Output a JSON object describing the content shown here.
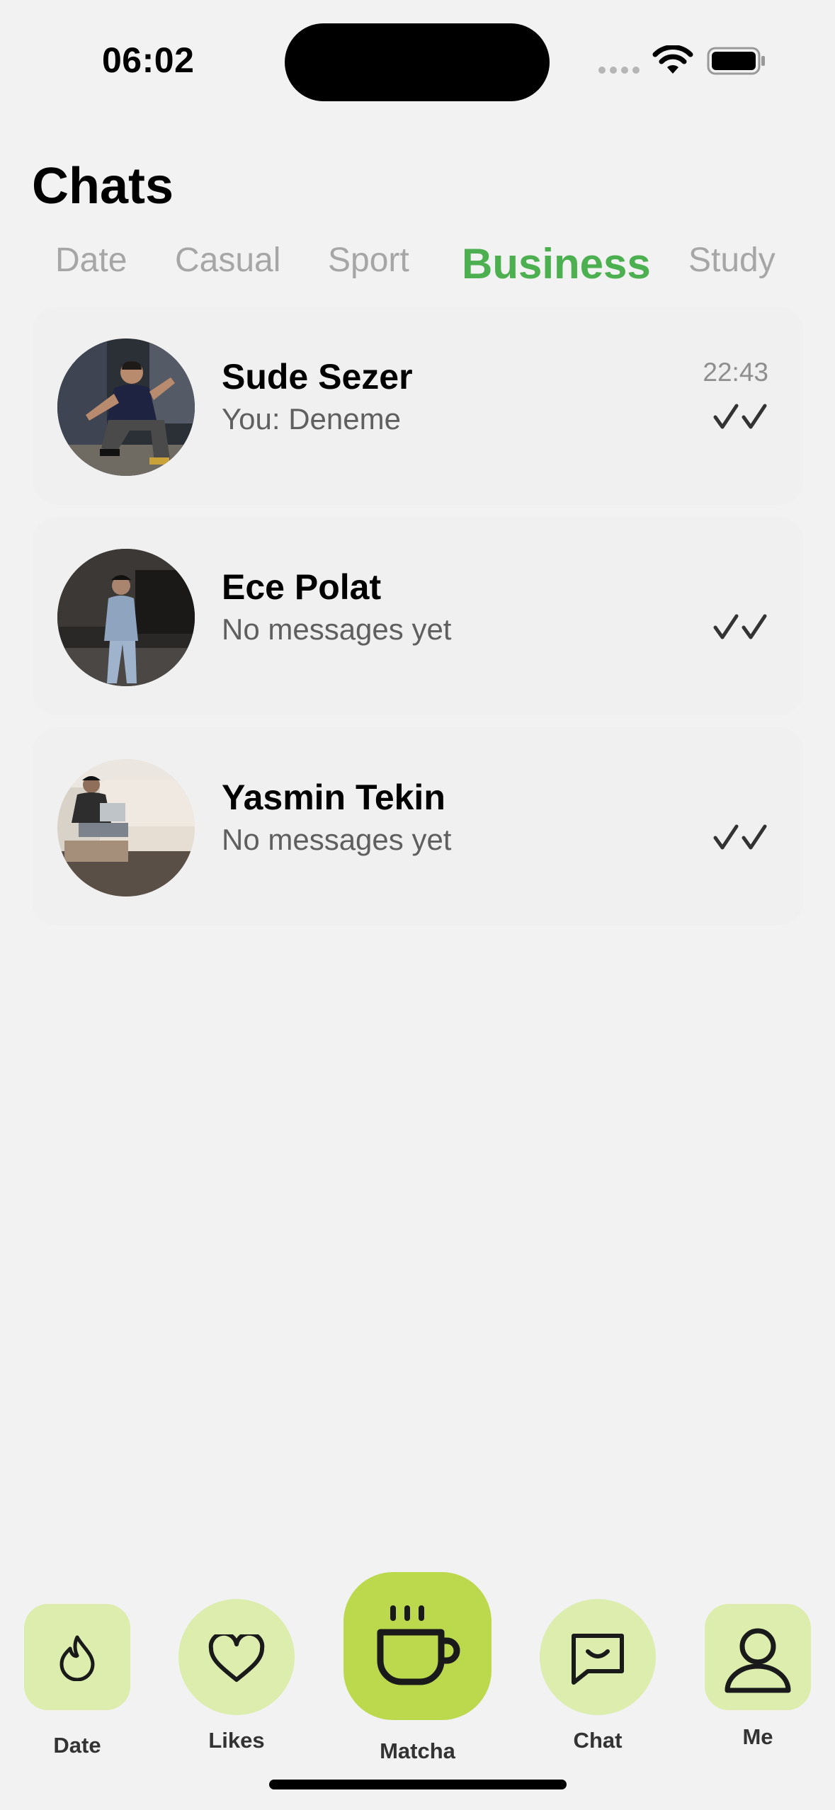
{
  "status_bar": {
    "time": "06:02"
  },
  "header": {
    "title": "Chats"
  },
  "tabs": [
    {
      "label": "Date",
      "active": false
    },
    {
      "label": "Casual",
      "active": false
    },
    {
      "label": "Sport",
      "active": false
    },
    {
      "label": "Business",
      "active": true
    },
    {
      "label": "Study",
      "active": false
    }
  ],
  "chats": [
    {
      "name": "Sude Sezer",
      "preview": "You: Deneme",
      "time": "22:43",
      "status": "double-check-icon"
    },
    {
      "name": "Ece Polat",
      "preview": "No messages yet",
      "time": "",
      "status": "double-check-icon"
    },
    {
      "name": "Yasmin Tekin",
      "preview": "No messages yet",
      "time": "",
      "status": "double-check-icon"
    }
  ],
  "nav": {
    "items": [
      {
        "label": "Date",
        "icon": "flame-icon"
      },
      {
        "label": "Likes",
        "icon": "heart-icon"
      },
      {
        "label": "Matcha",
        "icon": "cup-icon"
      },
      {
        "label": "Chat",
        "icon": "chat-bubble-icon"
      },
      {
        "label": "Me",
        "icon": "person-icon"
      }
    ]
  },
  "colors": {
    "accent": "#4caf50",
    "nav_bg": "#dcedae",
    "nav_center": "#bcd84d",
    "background": "#f2f2f2"
  }
}
